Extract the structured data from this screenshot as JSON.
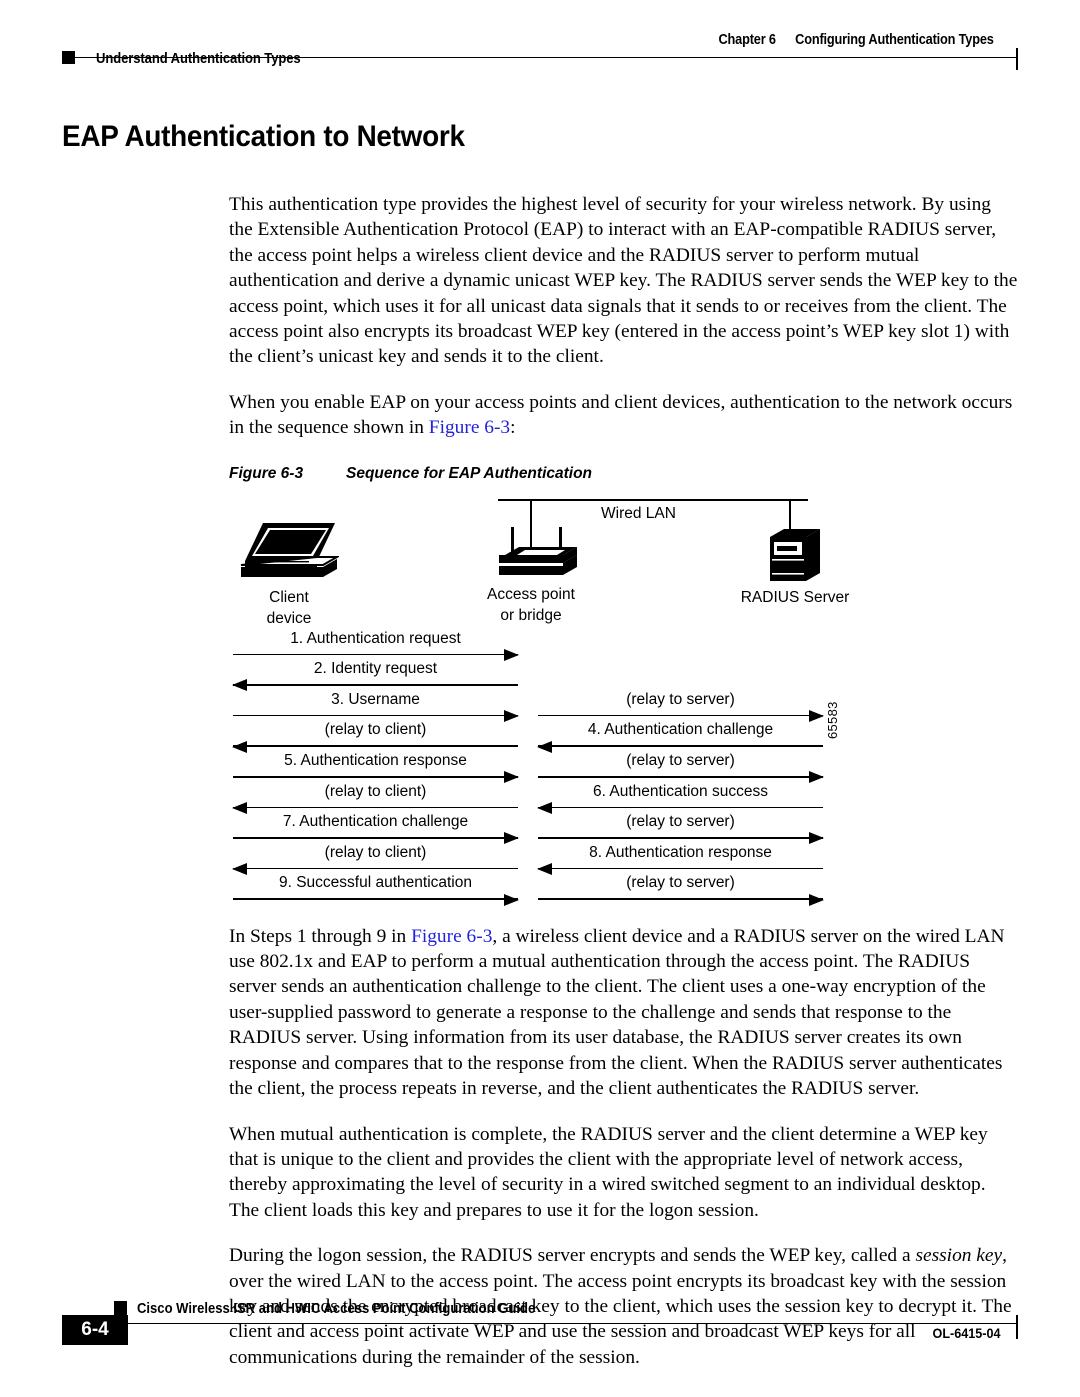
{
  "header": {
    "chapter_num": "Chapter 6",
    "chapter_title": "Configuring Authentication Types",
    "running_subtitle": "Understand Authentication Types"
  },
  "section": {
    "title": "EAP Authentication to Network"
  },
  "paragraphs": {
    "p1": "This authentication type provides the highest level of security for your wireless network. By using the Extensible Authentication Protocol (EAP) to interact with an EAP-compatible RADIUS server, the access point helps a wireless client device and the RADIUS server to perform mutual authentication and derive a dynamic unicast WEP key. The RADIUS server sends the WEP key to the access point, which uses it for all unicast data signals that it sends to or receives from the client. The access point also encrypts its broadcast WEP key (entered in the access point’s WEP key slot 1) with the client’s unicast key and sends it to the client.",
    "p2_before_link": "When you enable EAP on your access points and client devices, authentication to the network occurs in the sequence shown in ",
    "p2_link": "Figure 6-3",
    "p2_after_link": ":",
    "p3_before_link": "In Steps 1 through 9 in ",
    "p3_link": "Figure 6-3",
    "p3_after_link": ", a wireless client device and a RADIUS server on the wired LAN use 802.1x and EAP to perform a mutual authentication through the access point. The RADIUS server sends an authentication challenge to the client. The client uses a one-way encryption of the user-supplied password to generate a response to the challenge and sends that response to the RADIUS server. Using information from its user database, the RADIUS server creates its own response and compares that to the response from the client. When the RADIUS server authenticates the client, the process repeats in reverse, and the client authenticates the RADIUS server.",
    "p4": "When mutual authentication is complete, the RADIUS server and the client determine a WEP key that is unique to the client and provides the client with the appropriate level of network access, thereby approximating the level of security in a wired switched segment to an individual desktop. The client loads this key and prepares to use it for the logon session.",
    "p5_before_italic": "During the logon session, the RADIUS server encrypts and sends the WEP key, called a ",
    "p5_italic": "session key",
    "p5_after_italic": ", over the wired LAN to the access point. The access point encrypts its broadcast key with the session key and sends the encrypted broadcast key to the client, which uses the session key to decrypt it. The client and access point activate WEP and use the session and broadcast WEP keys for all communications during the remainder of the session."
  },
  "figure": {
    "caption_number": "Figure 6-3",
    "caption_title": "Sequence for EAP Authentication",
    "figure_id": "65583",
    "network_label": "Wired LAN",
    "nodes": [
      {
        "icon": "laptop-icon",
        "label_line1": "Client",
        "label_line2": "device"
      },
      {
        "icon": "access-point-icon",
        "label_line1": "Access point",
        "label_line2": "or bridge"
      },
      {
        "icon": "server-tower-icon",
        "label_line1": "RADIUS Server",
        "label_line2": ""
      }
    ],
    "sequence": [
      {
        "left_text": "1. Authentication request",
        "left_dir": "right",
        "right_text": "",
        "right_dir": "none"
      },
      {
        "left_text": "2. Identity request",
        "left_dir": "left",
        "right_text": "",
        "right_dir": "none"
      },
      {
        "left_text": "3. Username",
        "left_dir": "right",
        "right_text": "(relay to server)",
        "right_dir": "right"
      },
      {
        "left_text": "(relay to client)",
        "left_dir": "left",
        "right_text": "4. Authentication challenge",
        "right_dir": "left"
      },
      {
        "left_text": "5. Authentication response",
        "left_dir": "right",
        "right_text": "(relay to server)",
        "right_dir": "right"
      },
      {
        "left_text": "(relay to client)",
        "left_dir": "left",
        "right_text": "6. Authentication success",
        "right_dir": "left"
      },
      {
        "left_text": "7. Authentication challenge",
        "left_dir": "right",
        "right_text": "(relay to server)",
        "right_dir": "right"
      },
      {
        "left_text": "(relay to client)",
        "left_dir": "left",
        "right_text": "8. Authentication response",
        "right_dir": "left"
      },
      {
        "left_text": "9. Successful authentication",
        "left_dir": "right",
        "right_text": "(relay to server)",
        "right_dir": "right"
      }
    ]
  },
  "footer": {
    "guide_title": "Cisco Wireless ISR and HWIC Access Point Configuration Guide",
    "page_number": "6-4",
    "doc_id": "OL-6415-04"
  },
  "colors": {
    "link": "#2222dd",
    "text": "#000000",
    "background": "#ffffff"
  }
}
